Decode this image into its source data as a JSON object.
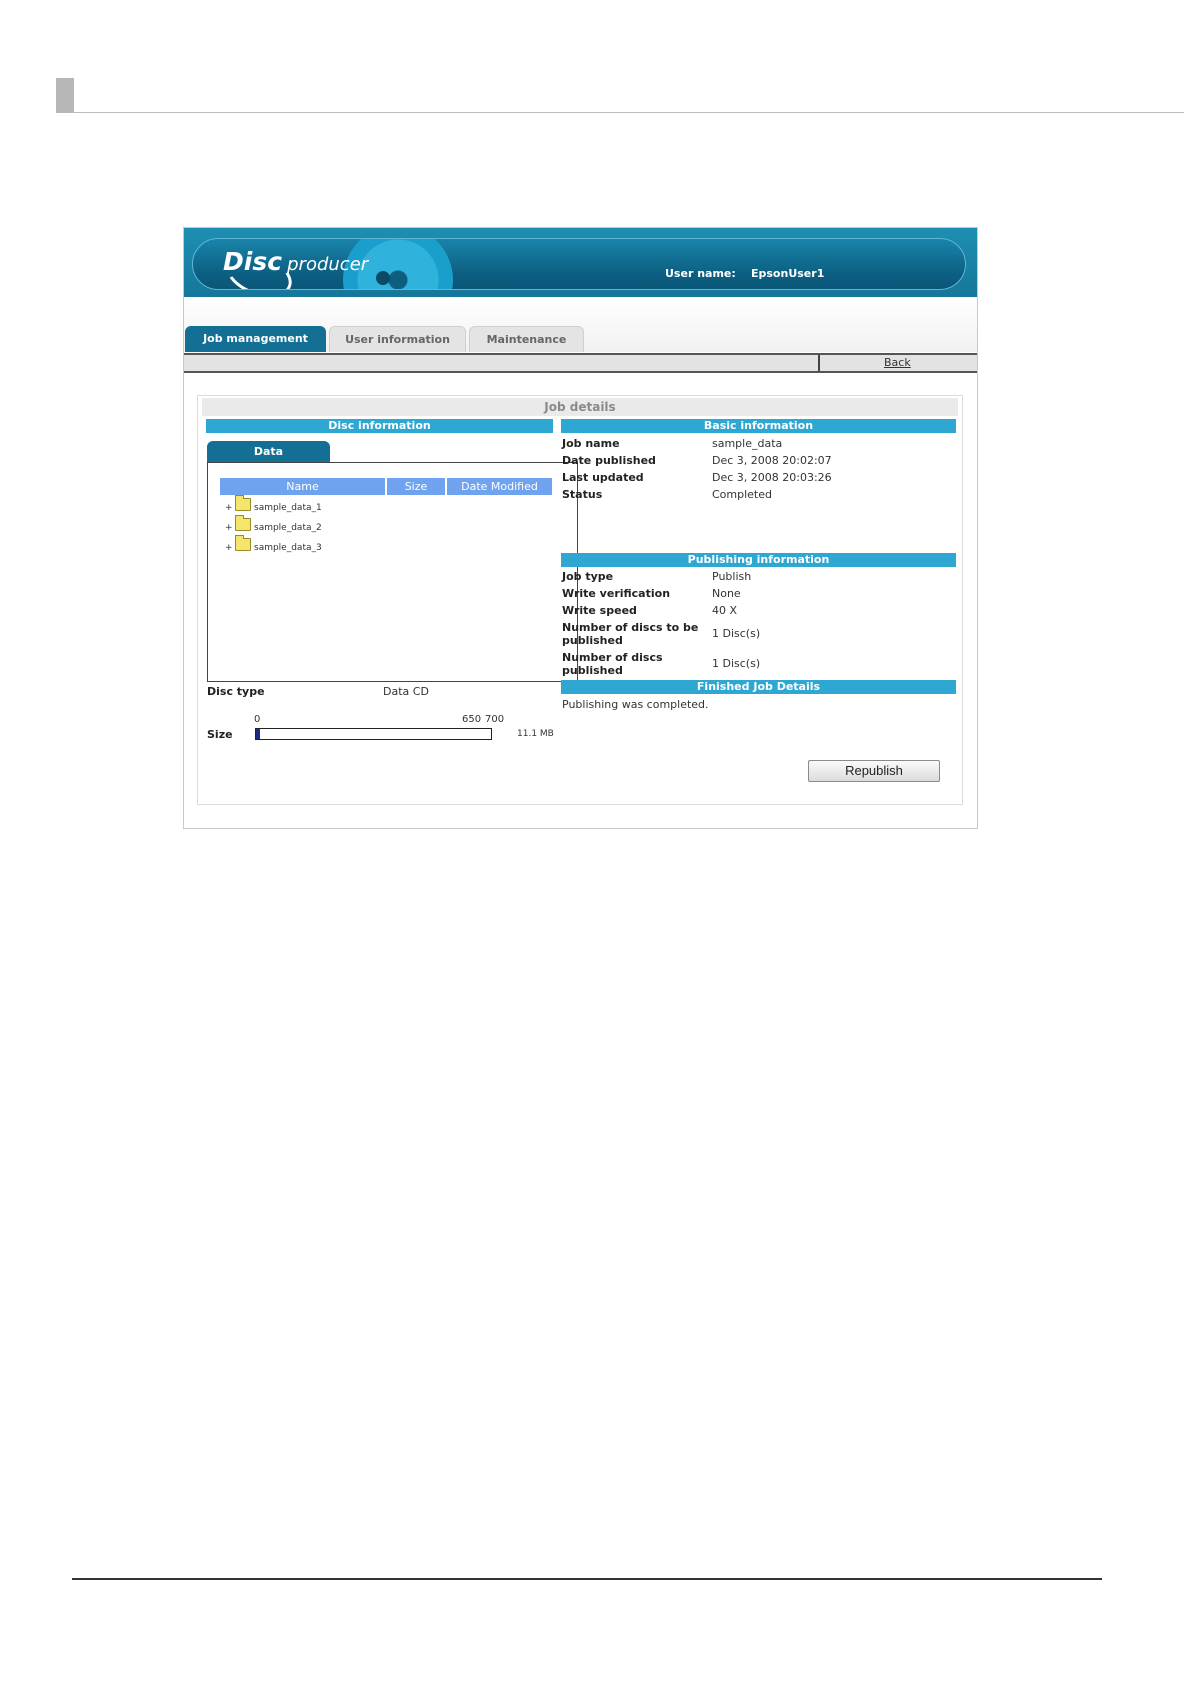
{
  "header": {
    "logo_disc": "Disc",
    "logo_producer": "producer",
    "user_label": "User name:",
    "user_name": "EpsonUser1"
  },
  "tabs": [
    "Job management",
    "User information",
    "Maintenance"
  ],
  "toolbar": {
    "back": "Back"
  },
  "job_details": {
    "title": "Job details",
    "disc_info": {
      "title": "Disc information",
      "data_tab": "Data",
      "columns": [
        "Name",
        "Size",
        "Date Modified"
      ],
      "files": [
        {
          "expander": "+",
          "name": "sample_data_1"
        },
        {
          "expander": "+",
          "name": "sample_data_2"
        },
        {
          "expander": "+",
          "name": "sample_data_3"
        }
      ],
      "disc_type_label": "Disc type",
      "disc_type_value": "Data CD",
      "size_label": "Size",
      "size_ticks": [
        "0",
        "650",
        "700"
      ],
      "size_value": "11.1 MB",
      "size_used_fraction": 0.016
    },
    "basic_info": {
      "title": "Basic information",
      "rows": [
        {
          "label": "Job name",
          "value": "sample_data"
        },
        {
          "label": "Date published",
          "value": "Dec 3, 2008 20:02:07"
        },
        {
          "label": "Last updated",
          "value": "Dec 3, 2008 20:03:26"
        },
        {
          "label": "Status",
          "value": "Completed"
        }
      ]
    },
    "publishing_info": {
      "title": "Publishing information",
      "rows": [
        {
          "label": "Job type",
          "value": "Publish"
        },
        {
          "label": "Write verification",
          "value": "None"
        },
        {
          "label": "Write speed",
          "value": "40 X"
        },
        {
          "label_line1": "Number of discs to be",
          "label_line2": "published",
          "value": "1 Disc(s)"
        },
        {
          "label_line1": "Number of discs",
          "label_line2": "published",
          "value": "1 Disc(s)"
        }
      ]
    },
    "finished": {
      "title": "Finished Job Details",
      "message": "Publishing was completed."
    },
    "republish_button": "Republish"
  },
  "colors": {
    "header_blue": "#136f93",
    "section_blue": "#2ea7d3",
    "column_header_blue": "#6fa3f0"
  }
}
